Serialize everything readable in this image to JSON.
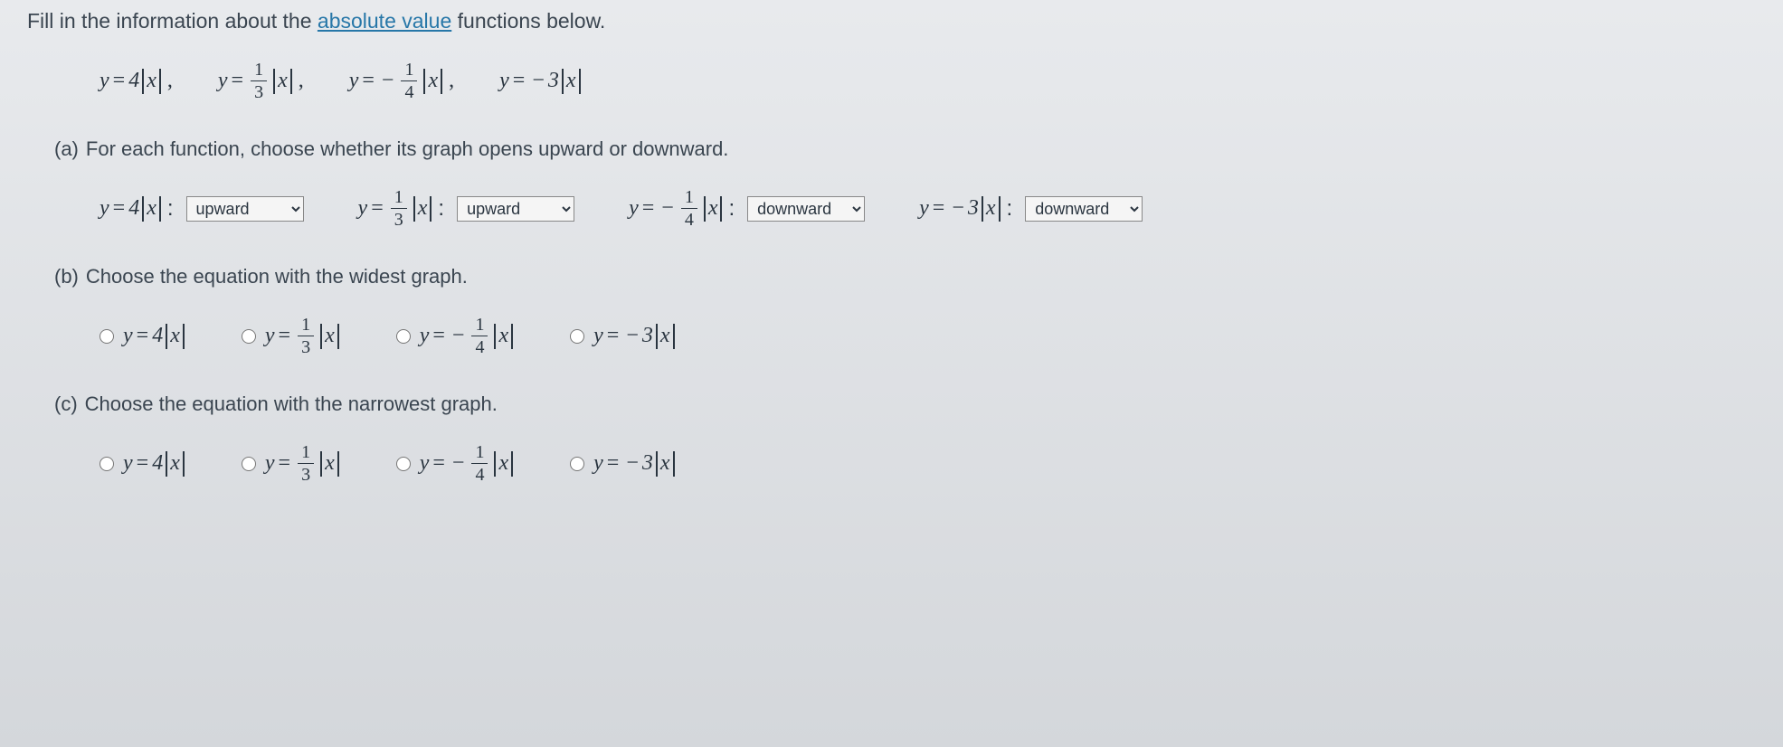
{
  "intro": {
    "prefix": "Fill in the information about the ",
    "link_text": "absolute value",
    "suffix": " functions below."
  },
  "functions": [
    {
      "label": "y = 4|x|",
      "coef": "4",
      "neg": false,
      "frac": null
    },
    {
      "label": "y = (1/3)|x|",
      "coef": null,
      "neg": false,
      "frac": {
        "num": "1",
        "den": "3"
      }
    },
    {
      "label": "y = -(1/4)|x|",
      "coef": null,
      "neg": true,
      "frac": {
        "num": "1",
        "den": "4"
      }
    },
    {
      "label": "y = -3|x|",
      "coef": "3",
      "neg": true,
      "frac": null
    }
  ],
  "part_a": {
    "label": "(a)",
    "text": "For each function, choose whether its graph opens upward or downward.",
    "options": [
      "upward",
      "downward"
    ],
    "selections": [
      "upward",
      "upward",
      "downward",
      "downward"
    ]
  },
  "part_b": {
    "label": "(b)",
    "text": "Choose the equation with the widest graph."
  },
  "part_c": {
    "label": "(c)",
    "text": "Choose the equation with the narrowest graph."
  },
  "math": {
    "y": "y",
    "x": "x",
    "eq": "=",
    "minus": "−",
    "comma": ","
  }
}
